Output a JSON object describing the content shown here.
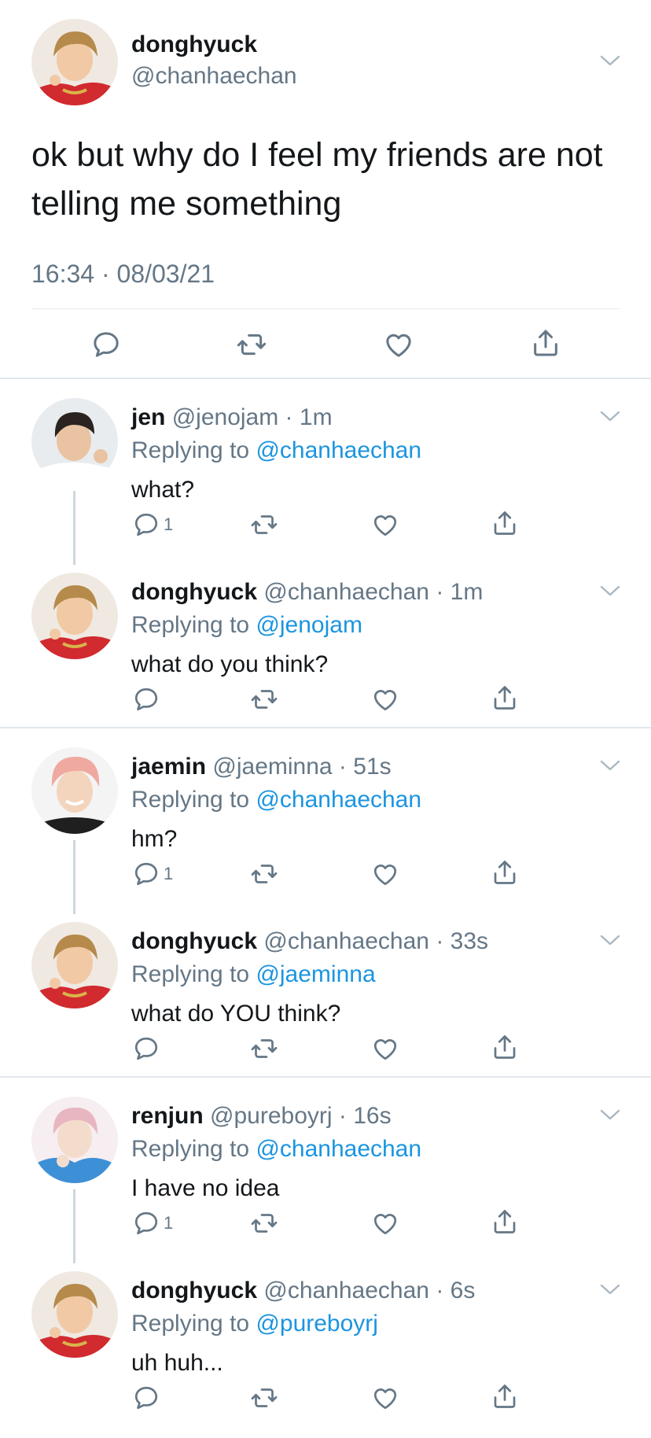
{
  "colors": {
    "text": "#14171a",
    "muted": "#657786",
    "accent": "#1b95e0",
    "divider": "#e1e8ed",
    "thread": "#ccd6dd"
  },
  "main_tweet": {
    "name": "donghyuck",
    "handle": "@chanhaechan",
    "text": "ok but why do I feel my friends are not telling me something",
    "time": "16:34 · 08/03/21",
    "avatar": "user-avatar-donghyuck",
    "actions": [
      "reply-icon",
      "retweet-icon",
      "like-icon",
      "share-icon"
    ]
  },
  "replies": [
    {
      "name": "jen",
      "handle": "@jenojam",
      "dot": " · ",
      "time": "1m",
      "replying_prefix": "Replying to ",
      "replying_to": "@chanhaechan",
      "text": "what?",
      "reply_count": "1",
      "avatar": "user-avatar-jen"
    },
    {
      "name": "donghyuck",
      "handle": "@chanhaechan",
      "dot": " · ",
      "time": "1m",
      "replying_prefix": "Replying to ",
      "replying_to": "@jenojam",
      "text": "what do you think?",
      "reply_count": "",
      "avatar": "user-avatar-donghyuck"
    },
    {
      "name": "jaemin",
      "handle": "@jaeminna",
      "dot": " · ",
      "time": "51s",
      "replying_prefix": "Replying to ",
      "replying_to": "@chanhaechan",
      "text": "hm?",
      "reply_count": "1",
      "avatar": "user-avatar-jaemin"
    },
    {
      "name": "donghyuck",
      "handle": "@chanhaechan",
      "dot": " · ",
      "time": "33s",
      "replying_prefix": "Replying to ",
      "replying_to": "@jaeminna",
      "text": "what do YOU think?",
      "reply_count": "",
      "avatar": "user-avatar-donghyuck"
    },
    {
      "name": "renjun",
      "handle": "@pureboyrj",
      "dot": " · ",
      "time": "16s",
      "replying_prefix": "Replying to ",
      "replying_to": "@chanhaechan",
      "text": "I have no idea",
      "reply_count": "1",
      "avatar": "user-avatar-renjun"
    },
    {
      "name": "donghyuck",
      "handle": "@chanhaechan",
      "dot": " · ",
      "time": "6s",
      "replying_prefix": "Replying to ",
      "replying_to": "@pureboyrj",
      "text": "uh huh...",
      "reply_count": "",
      "avatar": "user-avatar-donghyuck"
    }
  ]
}
